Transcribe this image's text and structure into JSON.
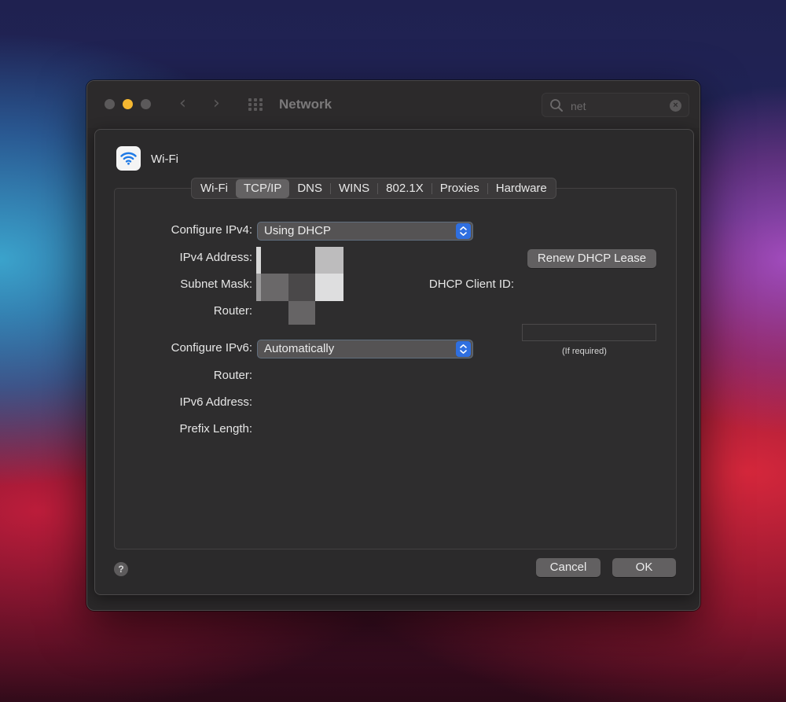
{
  "window": {
    "title": "Network",
    "search": {
      "value": "net"
    }
  },
  "sheet": {
    "service_name": "Wi-Fi",
    "tabs": [
      {
        "label": "Wi-Fi",
        "selected": false
      },
      {
        "label": "TCP/IP",
        "selected": true
      },
      {
        "label": "DNS",
        "selected": false
      },
      {
        "label": "WINS",
        "selected": false
      },
      {
        "label": "802.1X",
        "selected": false
      },
      {
        "label": "Proxies",
        "selected": false
      },
      {
        "label": "Hardware",
        "selected": false
      }
    ],
    "ipv4": {
      "configure_label": "Configure IPv4:",
      "configure_value": "Using DHCP",
      "address_label": "IPv4 Address:",
      "subnet_label": "Subnet Mask:",
      "router_label": "Router:",
      "renew_button": "Renew DHCP Lease",
      "client_id_label": "DHCP Client ID:",
      "client_id_value": "",
      "client_id_note": "(If required)"
    },
    "ipv6": {
      "configure_label": "Configure IPv6:",
      "configure_value": "Automatically",
      "router_label": "Router:",
      "address_label": "IPv6 Address:",
      "prefix_label": "Prefix Length:"
    },
    "buttons": {
      "help": "?",
      "cancel": "Cancel",
      "ok": "OK"
    }
  },
  "colors": {
    "accent": "#2f6fe0",
    "traffic_minimize": "#f5b731",
    "window_bg": "#2a2829"
  }
}
